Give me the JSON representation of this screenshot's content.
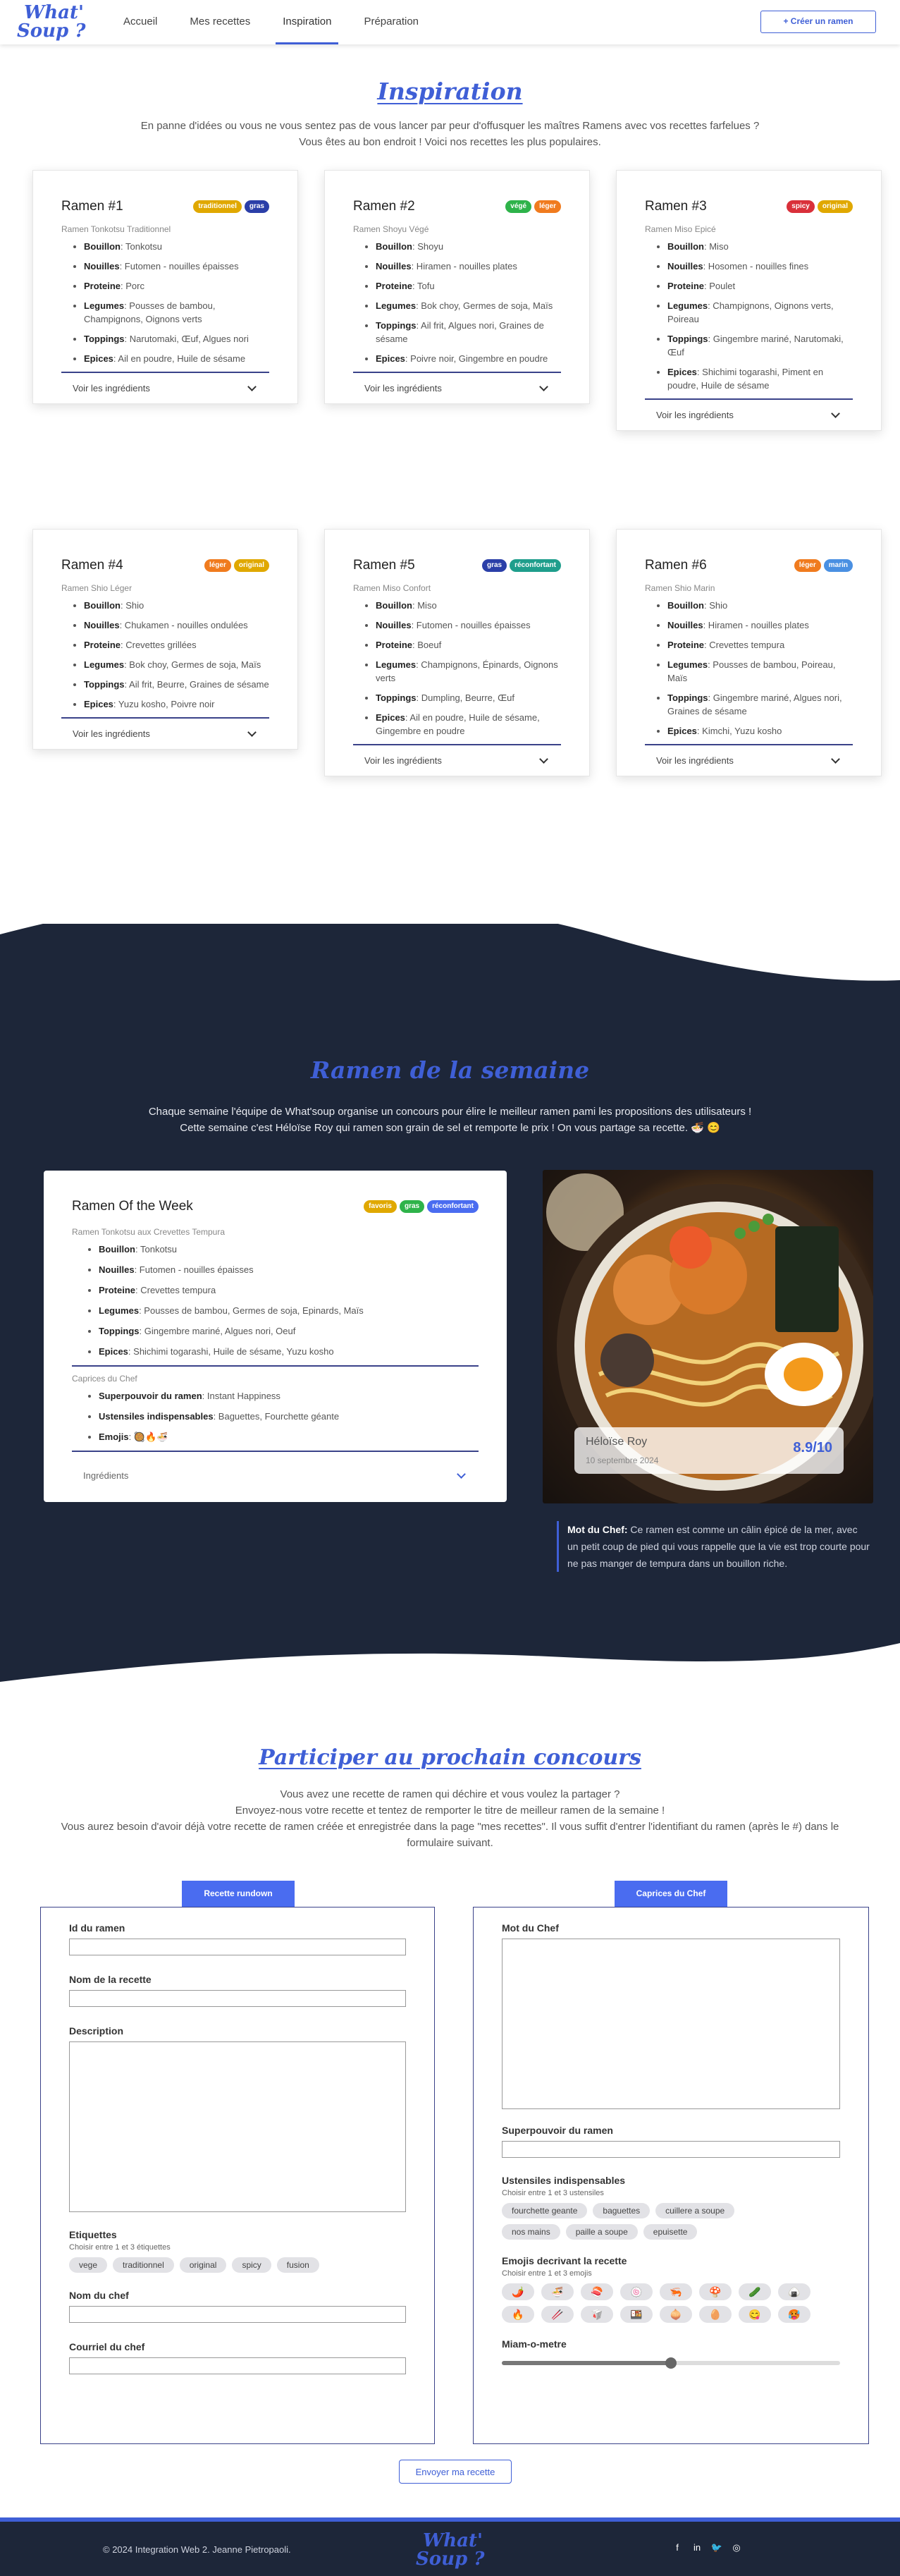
{
  "nav": {
    "logo_line1": "What'",
    "logo_line2": "Soup ?",
    "links": [
      "Accueil",
      "Mes recettes",
      "Inspiration",
      "Préparation"
    ],
    "cta": "+ Créer un ramen"
  },
  "inspiration": {
    "title": "Inspiration",
    "subtitle_line1": "En panne d'idées ou vous ne vous sentez pas de vous lancer par peur d'offusquer les maîtres Ramens avec vos recettes farfelues ?",
    "subtitle_line2": "Vous êtes au bon endroit ! Voici nos recettes les plus populaires.",
    "toggle_label": "Voir les ingrédients",
    "cards": [
      {
        "title": "Ramen #1",
        "subtitle": "Ramen Tonkotsu Traditionnel",
        "badges": [
          {
            "label": "traditionnel",
            "color": "#e0a800"
          },
          {
            "label": "gras",
            "color": "#2b3fa8"
          }
        ],
        "items": [
          [
            "Bouillon",
            ": Tonkotsu"
          ],
          [
            "Nouilles",
            ": Futomen - nouilles épaisses"
          ],
          [
            "Proteine",
            ": Porc"
          ],
          [
            "Legumes",
            ": Pousses de bambou, Champignons, Oignons verts"
          ],
          [
            "Toppings",
            ": Narutomaki, Œuf, Algues nori"
          ],
          [
            "Epices",
            ": Ail en poudre, Huile de sésame"
          ]
        ]
      },
      {
        "title": "Ramen #2",
        "subtitle": "Ramen Shoyu Végé",
        "badges": [
          {
            "label": "végé",
            "color": "#2eb34a"
          },
          {
            "label": "léger",
            "color": "#f07b1e"
          }
        ],
        "items": [
          [
            "Bouillon",
            ": Shoyu"
          ],
          [
            "Nouilles",
            ": Hiramen - nouilles plates"
          ],
          [
            "Proteine",
            ": Tofu"
          ],
          [
            "Legumes",
            ": Bok choy, Germes de soja, Maïs"
          ],
          [
            "Toppings",
            ": Ail frit, Algues nori, Graines de sésame"
          ],
          [
            "Epices",
            ": Poivre noir, Gingembre en poudre"
          ]
        ]
      },
      {
        "title": "Ramen #3",
        "subtitle": "Ramen Miso Epicé",
        "badges": [
          {
            "label": "spicy",
            "color": "#d9303a"
          },
          {
            "label": "original",
            "color": "#e0a800"
          }
        ],
        "items": [
          [
            "Bouillon",
            ": Miso"
          ],
          [
            "Nouilles",
            ": Hosomen - nouilles fines"
          ],
          [
            "Proteine",
            ": Poulet"
          ],
          [
            "Legumes",
            ": Champignons, Oignons verts, Poireau"
          ],
          [
            "Toppings",
            ": Gingembre mariné, Narutomaki, Œuf"
          ],
          [
            "Epices",
            ": Shichimi togarashi, Piment en poudre, Huile de sésame"
          ]
        ]
      },
      {
        "title": "Ramen #4",
        "subtitle": "Ramen Shio Léger",
        "badges": [
          {
            "label": "léger",
            "color": "#f07b1e"
          },
          {
            "label": "original",
            "color": "#e0a800"
          }
        ],
        "items": [
          [
            "Bouillon",
            ": Shio"
          ],
          [
            "Nouilles",
            ": Chukamen - nouilles ondulées"
          ],
          [
            "Proteine",
            ": Crevettes grillées"
          ],
          [
            "Legumes",
            ": Bok choy, Germes de soja, Maïs"
          ],
          [
            "Toppings",
            ": Ail frit, Beurre, Graines de sésame"
          ],
          [
            "Epices",
            ": Yuzu kosho, Poivre noir"
          ]
        ]
      },
      {
        "title": "Ramen #5",
        "subtitle": "Ramen Miso Confort",
        "badges": [
          {
            "label": "gras",
            "color": "#2b3fa8"
          },
          {
            "label": "réconfortant",
            "color": "#1f9e8c"
          }
        ],
        "items": [
          [
            "Bouillon",
            ": Miso"
          ],
          [
            "Nouilles",
            ": Futomen - nouilles épaisses"
          ],
          [
            "Proteine",
            ": Boeuf"
          ],
          [
            "Legumes",
            ": Champignons, Épinards, Oignons verts"
          ],
          [
            "Toppings",
            ": Dumpling, Beurre, Œuf"
          ],
          [
            "Epices",
            ": Ail en poudre, Huile de sésame, Gingembre en poudre"
          ]
        ]
      },
      {
        "title": "Ramen #6",
        "subtitle": "Ramen Shio Marin",
        "badges": [
          {
            "label": "léger",
            "color": "#f07b1e"
          },
          {
            "label": "marin",
            "color": "#4a90e2"
          }
        ],
        "items": [
          [
            "Bouillon",
            ": Shio"
          ],
          [
            "Nouilles",
            ": Hiramen - nouilles plates"
          ],
          [
            "Proteine",
            ": Crevettes tempura"
          ],
          [
            "Legumes",
            ": Pousses de bambou, Poireau, Maïs"
          ],
          [
            "Toppings",
            ": Gingembre mariné, Algues nori, Graines de sésame"
          ],
          [
            "Epices",
            ": Kimchi, Yuzu kosho"
          ]
        ]
      }
    ]
  },
  "week": {
    "title": "Ramen de la semaine",
    "subtitle_line1": "Chaque semaine l'équipe de What'soup organise un concours pour élire le meilleur ramen pami les propositions des utilisateurs !",
    "subtitle_line2": "Cette semaine c'est Héloïse Roy qui ramen son grain de sel et remporte le prix ! On vous partage sa recette. 🍜 😊",
    "card_title": "Ramen Of the Week",
    "badges": [
      {
        "label": "favoris",
        "color": "#e0a800"
      },
      {
        "label": "gras",
        "color": "#2eb34a"
      },
      {
        "label": "réconfortant",
        "color": "#4a6cf0"
      }
    ],
    "card_subtitle": "Ramen Tonkotsu aux Crevettes Tempura",
    "items": [
      [
        "Bouillon",
        ": Tonkotsu"
      ],
      [
        "Nouilles",
        ": Futomen - nouilles épaisses"
      ],
      [
        "Proteine",
        ": Crevettes tempura"
      ],
      [
        "Legumes",
        ": Pousses de bambou, Germes de soja, Epinards, Maïs"
      ],
      [
        "Toppings",
        ": Gingembre mariné, Algues nori, Oeuf"
      ],
      [
        "Epices",
        ": Shichimi togarashi, Huile de sésame, Yuzu kosho"
      ]
    ],
    "caprices_title": "Caprices du Chef",
    "caprices": [
      [
        "Superpouvoir du ramen",
        ": Instant Happiness"
      ],
      [
        "Ustensiles indispensables",
        ": Baguettes, Fourchette géante"
      ],
      [
        "Emojis",
        ": 🥘🔥🍜"
      ]
    ],
    "toggle_label": "Ingrédients",
    "chef_name": "Héloïse Roy",
    "chef_date": "10 septembre 2024",
    "rating": "8.9/10",
    "quote_label": "Mot du Chef:",
    "quote_text": " Ce ramen est comme un câlin épicé de la mer, avec un petit coup de pied qui vous rappelle que la vie est trop courte pour ne pas manger de tempura dans un bouillon riche."
  },
  "contest": {
    "title": "Participer au prochain concours",
    "line1": "Vous avez une recette de ramen qui déchire et vous voulez la partager ?",
    "line2": "Envoyez-nous votre recette et tentez de remporter le titre de meilleur ramen de la semaine !",
    "line3": "Vous aurez besoin d'avoir déjà votre recette de ramen créée et enregistrée dans la page \"mes recettes\". Il vous suffit d'entrer l'identifiant du ramen (après le #) dans le formulaire suivant.",
    "left_tab": "Recette rundown",
    "right_tab": "Caprices du Chef",
    "id_label": "Id du ramen",
    "name_label": "Nom de la recette",
    "desc_label": "Description",
    "tags_label": "Etiquettes",
    "tags_hint": "Choisir entre 1 et 3 étiquettes",
    "tags": [
      "vege",
      "traditionnel",
      "original",
      "spicy",
      "fusion"
    ],
    "chef_name_label": "Nom du chef",
    "chef_mail_label": "Courriel du chef",
    "mot_label": "Mot du Chef",
    "power_label": "Superpouvoir du ramen",
    "utensils_label": "Ustensiles indispensables",
    "utensils_hint": "Choisir entre 1 et 3 ustensiles",
    "utensils": [
      "fourchette geante",
      "baguettes",
      "cuillere a soupe",
      "nos mains",
      "paille a soupe",
      "epuisette"
    ],
    "emojis_label": "Emojis decrivant la recette",
    "emojis_hint": "Choisir entre 1 et 3 emojis",
    "emojis": [
      "🌶️",
      "🍜",
      "🍣",
      "🍥",
      "🦐",
      "🍄",
      "🥒",
      "🍙",
      "🔥",
      "🥢",
      "🥡",
      "🍱",
      "🧅",
      "🥚",
      "😋",
      "🥵"
    ],
    "slider_label": "Miam-o-metre",
    "slider_value": 0.5,
    "submit": "Envoyer ma recette"
  },
  "footer": {
    "copyright": "© 2024 Integration Web 2. Jeanne Pietropaoli.",
    "logo_line1": "What'",
    "logo_line2": "Soup ?",
    "social": [
      {
        "icon": "facebook-icon",
        "glyph": "f"
      },
      {
        "icon": "linkedin-icon",
        "glyph": "in"
      },
      {
        "icon": "twitter-icon",
        "glyph": "🐦"
      },
      {
        "icon": "instagram-icon",
        "glyph": "◎"
      }
    ]
  },
  "colors": {
    "accent": "#3f5fd6",
    "dark": "#1d2639"
  }
}
